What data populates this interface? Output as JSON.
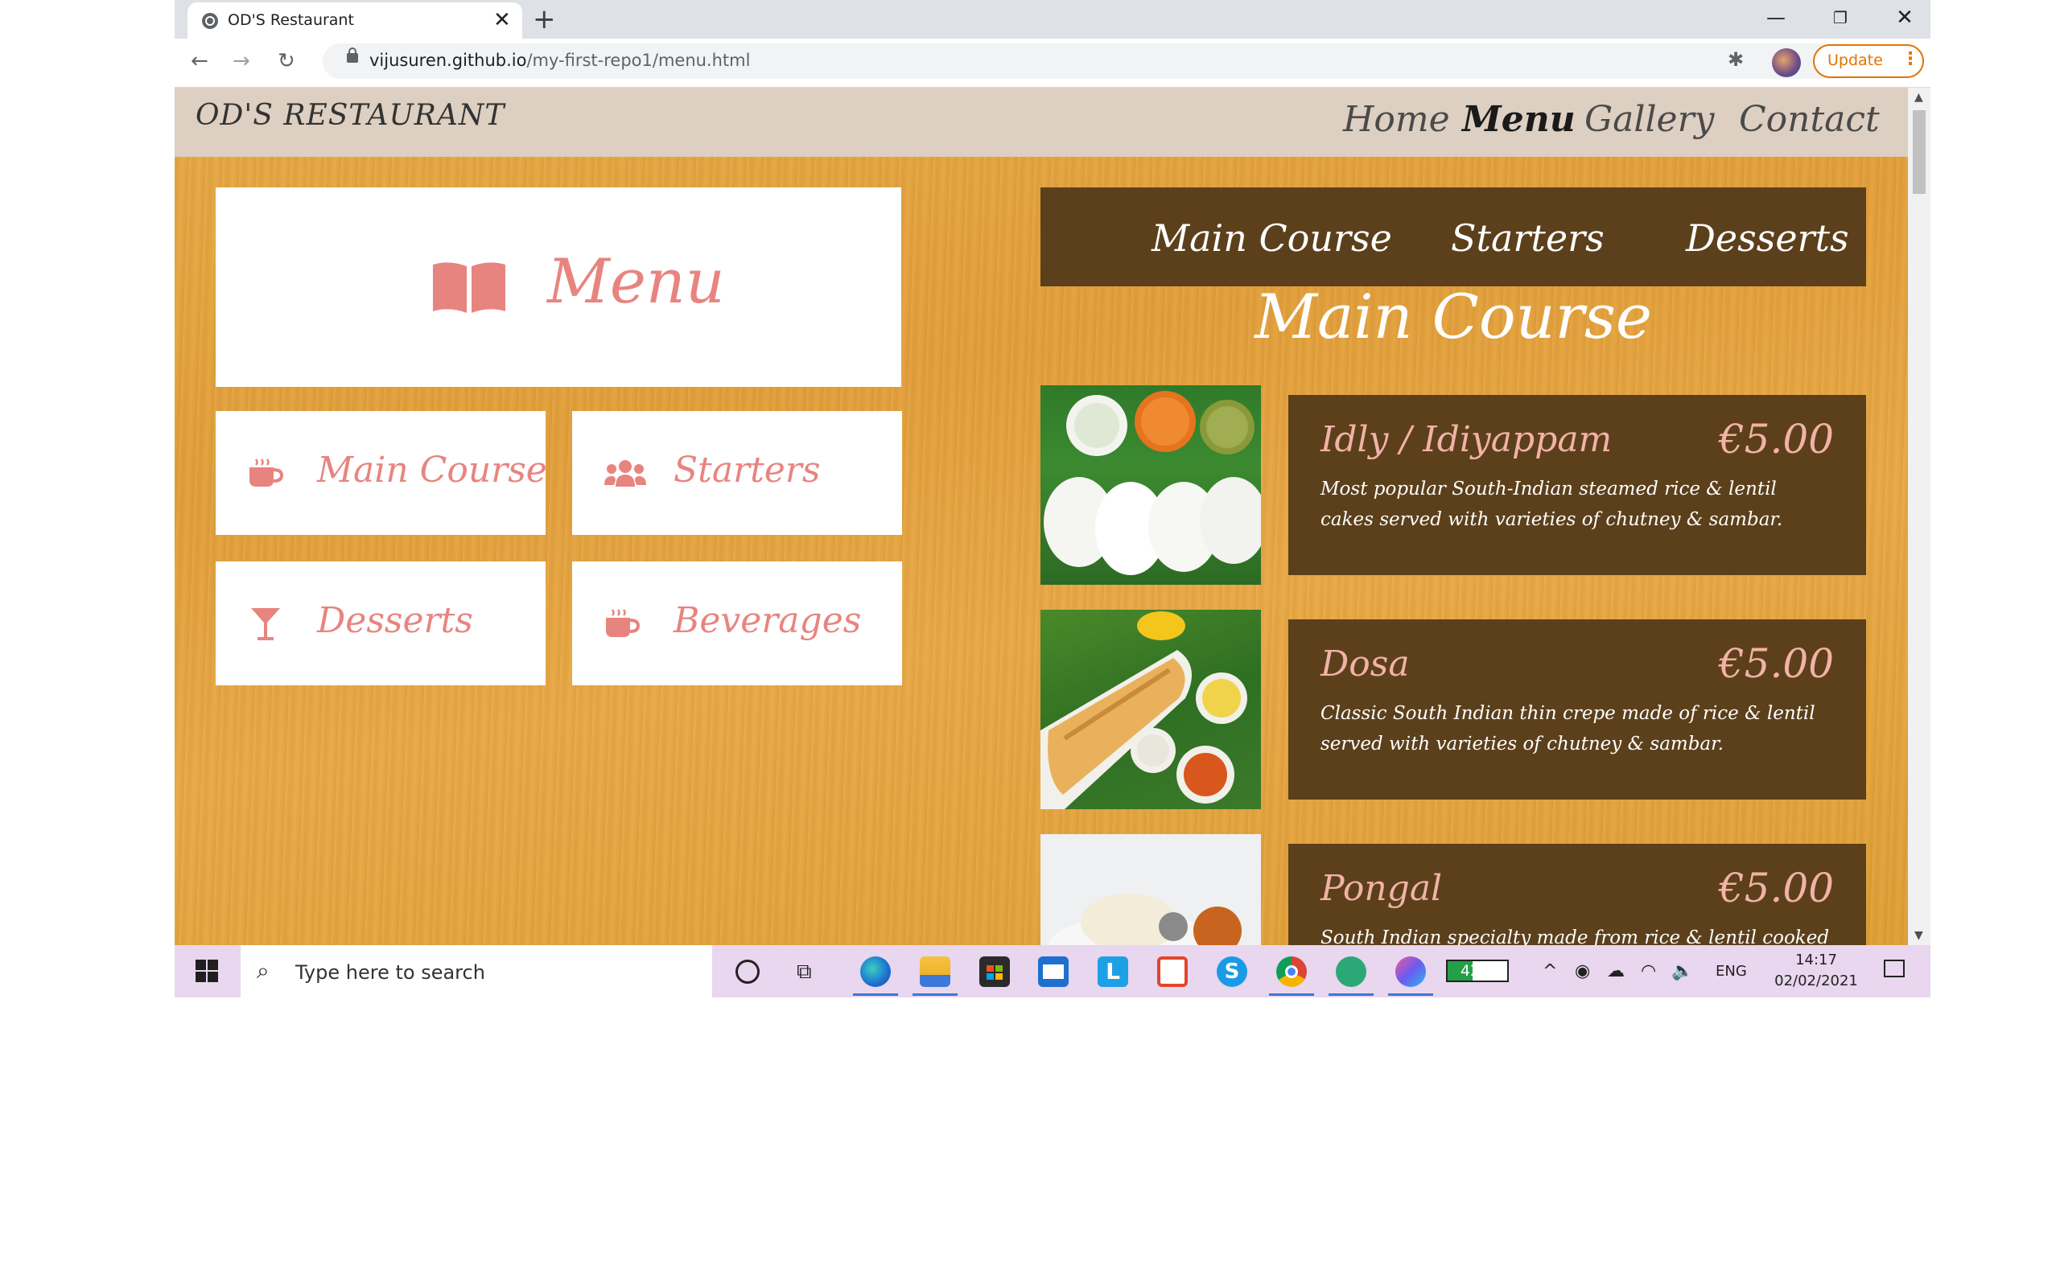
{
  "browser": {
    "tab_title": "OD'S Restaurant",
    "url_host": "vijusuren.github.io",
    "url_path": "/my-first-repo1/menu.html",
    "update_label": "Update"
  },
  "site": {
    "logo": "OD'S RESTAURANT",
    "nav": [
      "Home",
      "Menu",
      "Gallery",
      "Contact"
    ],
    "active_nav": "Menu"
  },
  "menu_panel": {
    "title": "Menu",
    "categories": [
      {
        "label": "Main Course",
        "icon": "coffee-cup-icon"
      },
      {
        "label": "Starters",
        "icon": "users-icon"
      },
      {
        "label": "Desserts",
        "icon": "cocktail-glass-icon"
      },
      {
        "label": "Beverages",
        "icon": "coffee-cup-icon"
      }
    ]
  },
  "tabs": [
    "Main Course",
    "Starters",
    "Desserts"
  ],
  "section_title": "Main Course",
  "dishes": [
    {
      "name": "Idly / Idiyappam",
      "price": "€5.00",
      "description": "Most popular South-Indian steamed rice & lentil cakes served with varieties of chutney & sambar."
    },
    {
      "name": "Dosa",
      "price": "€5.00",
      "description": "Classic South Indian thin crepe made of rice & lentil served with varieties of chutney & sambar."
    },
    {
      "name": "Pongal",
      "price": "€5.00",
      "description": "South Indian specialty made from rice & lentil cooked served"
    }
  ],
  "taskbar": {
    "search_placeholder": "Type here to search",
    "battery": "42%",
    "battery_level": 0.42,
    "language": "ENG",
    "time": "14:17",
    "date": "02/02/2021"
  },
  "colors": {
    "accent_pink": "#e8847f",
    "brown_panel": "#5c401b",
    "header_beige": "#ddcfc1",
    "update_orange": "#e37400"
  }
}
